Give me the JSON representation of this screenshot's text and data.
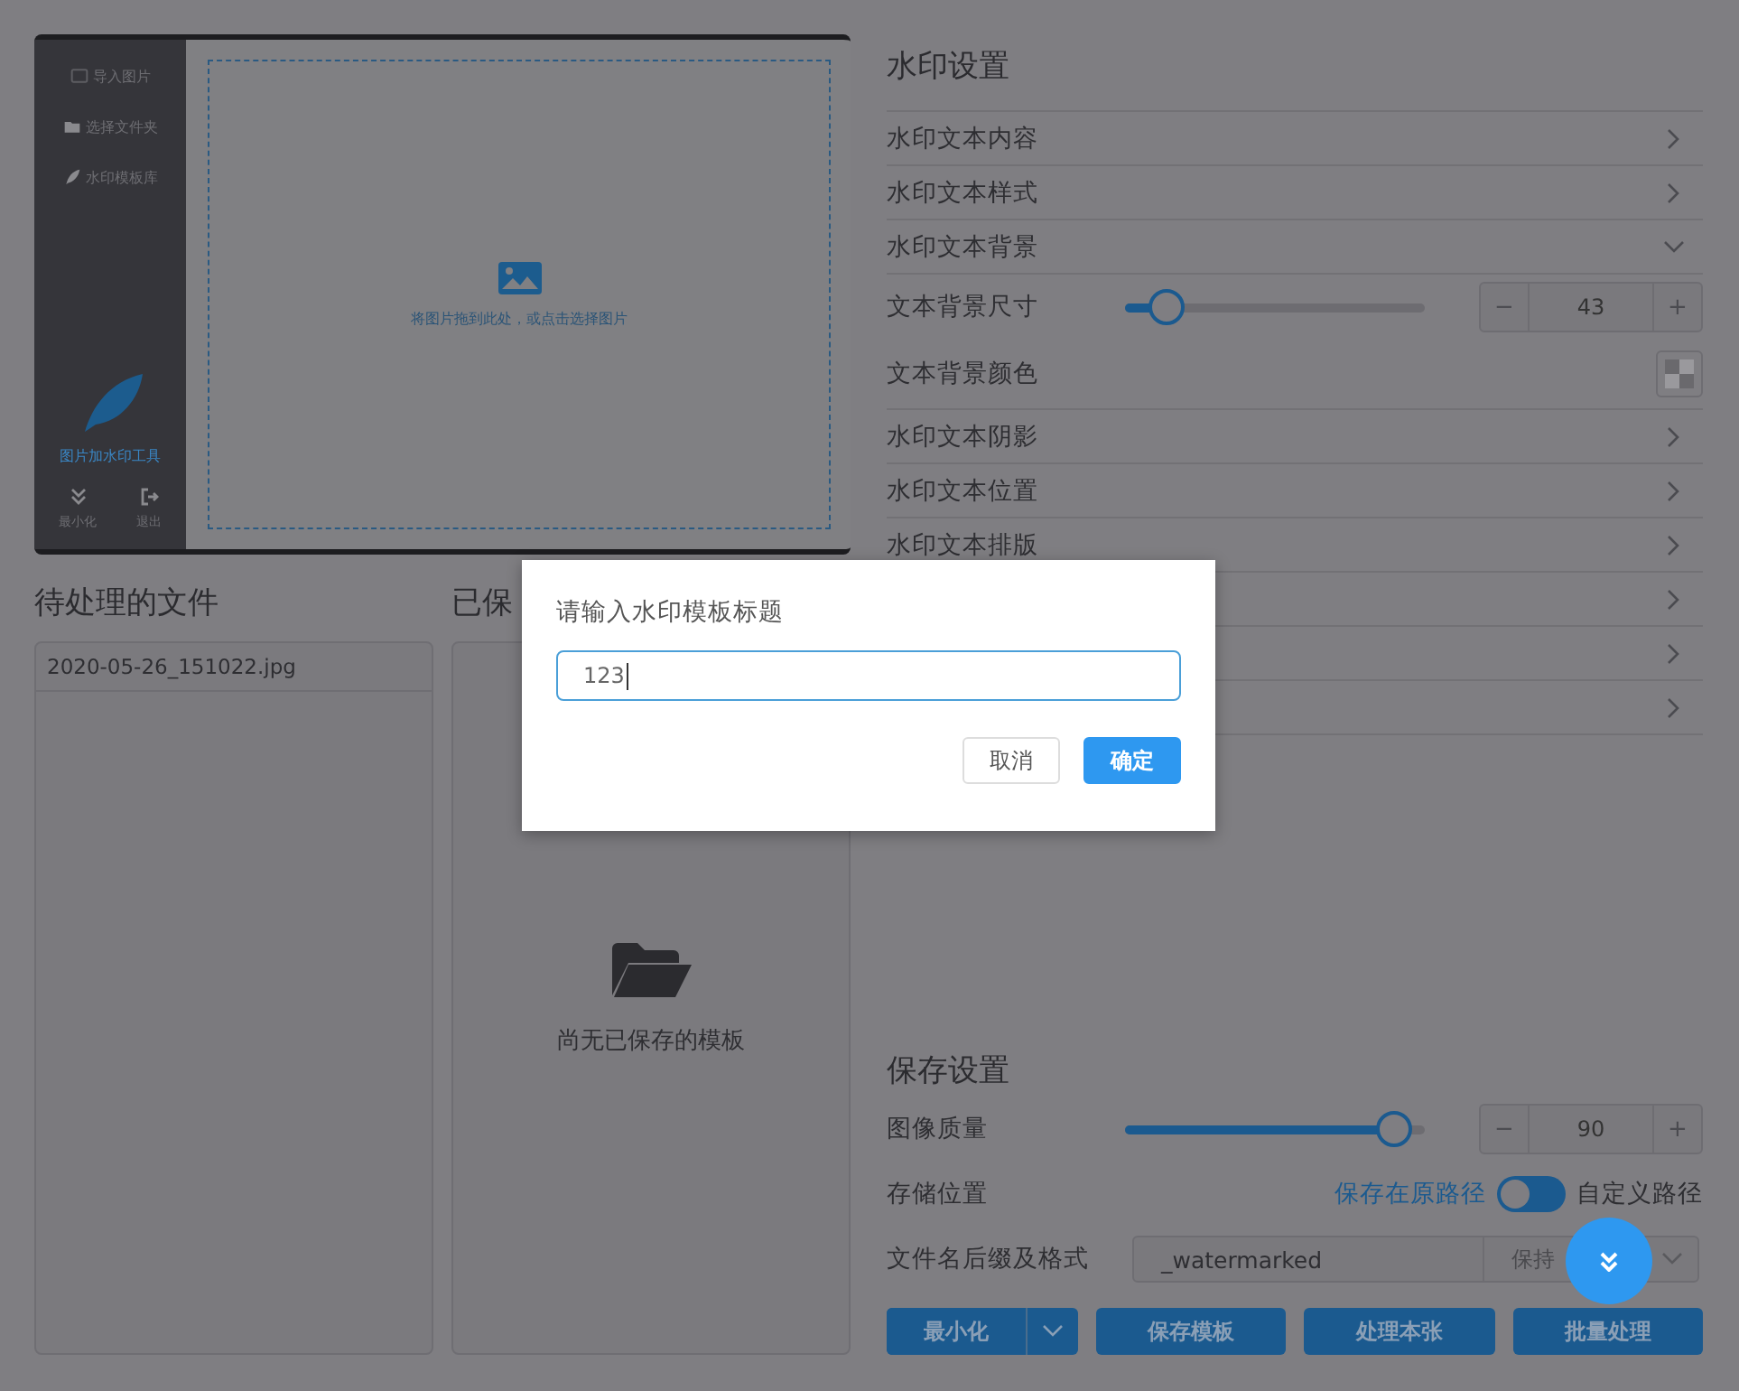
{
  "preview": {
    "sidebar_items": [
      {
        "label": "导入图片"
      },
      {
        "label": "选择文件夹"
      },
      {
        "label": "水印模板库"
      }
    ],
    "app_name": "图片加水印工具",
    "actions": [
      {
        "label": "最小化",
        "kind": "minimize"
      },
      {
        "label": "退出",
        "kind": "exit"
      }
    ],
    "drop_hint": "将图片拖到此处，或点击选择图片"
  },
  "pending": {
    "title": "待处理的文件",
    "files": [
      "2020-05-26_151022.jpg"
    ]
  },
  "saved": {
    "title": "已保",
    "empty": "尚无已保存的模板"
  },
  "watermark_settings": {
    "title": "水印设置",
    "rows": [
      {
        "kind": "section",
        "label": "水印文本内容",
        "expanded": false
      },
      {
        "kind": "section",
        "label": "水印文本样式",
        "expanded": false
      },
      {
        "kind": "section",
        "label": "水印文本背景",
        "expanded": true
      },
      {
        "kind": "slider",
        "label": "文本背景尺寸",
        "level": 0.14,
        "value": "43",
        "decrement": "−",
        "increment": "+"
      },
      {
        "kind": "color",
        "label": "文本背景颜色"
      },
      {
        "kind": "section",
        "label": "水印文本阴影",
        "expanded": false
      },
      {
        "kind": "section",
        "label": "水印文本位置",
        "expanded": false
      },
      {
        "kind": "section",
        "label": "水印文本排版",
        "expanded": false
      },
      {
        "kind": "section",
        "expanded": false
      },
      {
        "kind": "section",
        "expanded": false
      },
      {
        "kind": "section",
        "expanded": false
      }
    ]
  },
  "save_settings": {
    "title": "保存设置",
    "quality": {
      "label": "图像质量",
      "level": 0.9,
      "value": "90",
      "decrement": "−",
      "increment": "+"
    },
    "location": {
      "label": "存储位置",
      "option_off": "保存在原路径",
      "option_on": "自定义路径",
      "on": false
    },
    "filename": {
      "label": "文件名后缀及格式",
      "suffix": "_watermarked",
      "format": "保持"
    }
  },
  "actions": [
    {
      "label": "最小化",
      "kind": "split"
    },
    {
      "label": "保存模板",
      "kind": "plain"
    },
    {
      "label": "处理本张",
      "kind": "plain"
    },
    {
      "label": "批量处理",
      "kind": "plain"
    }
  ],
  "dialog": {
    "title": "请输入水印模板标题",
    "value": "123",
    "buttons": [
      {
        "label": "取消",
        "kind": "secondary"
      },
      {
        "label": "确定",
        "kind": "primary"
      }
    ]
  }
}
